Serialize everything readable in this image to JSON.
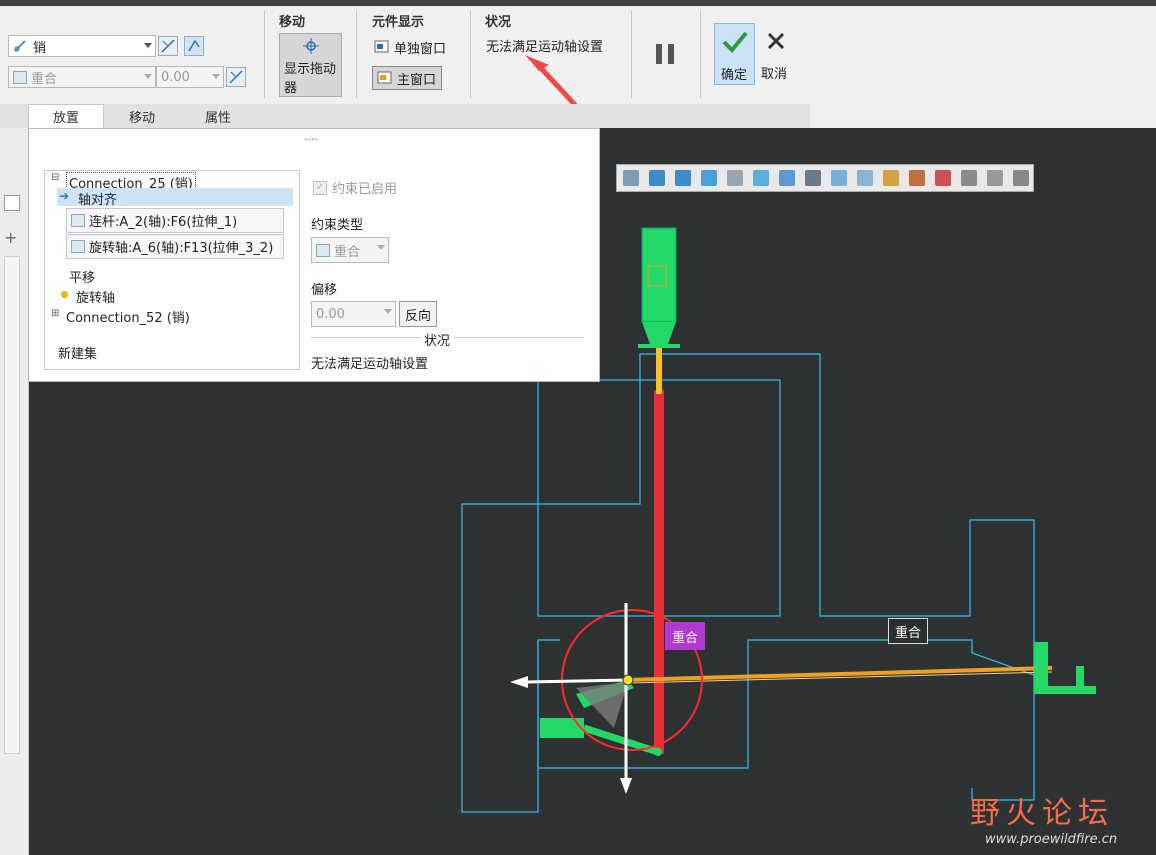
{
  "ribbon": {
    "connection_type": "销",
    "constraint_combo": "重合",
    "offset_value": "0.00",
    "groups": {
      "move": {
        "title": "移动",
        "drag_label_line1": "显示拖动",
        "drag_label_line2": "器"
      },
      "display": {
        "title": "元件显示",
        "separate_window": "单独窗口",
        "main_window": "主窗口"
      },
      "status": {
        "title": "状况",
        "message": "无法满足运动轴设置"
      },
      "confirm": {
        "ok": "确定",
        "cancel": "取消"
      }
    },
    "tabs": [
      "放置",
      "移动",
      "属性"
    ]
  },
  "panel": {
    "grip": "....",
    "tree": {
      "connection1": "Connection_25 (销)",
      "axis_align": "轴对齐",
      "ref1": "连杆:A_2(轴):F6(拉伸_1)",
      "ref2": "旋转轴:A_6(轴):F13(拉伸_3_2)",
      "translation": "平移",
      "rotation_axis": "旋转轴",
      "connection2": "Connection_52 (销)",
      "new_set": "新建集"
    },
    "enabled_label": "约束已启用",
    "constraint_type_label": "约束类型",
    "constraint_type_value": "重合",
    "offset_label": "偏移",
    "offset_value": "0.00",
    "flip_button": "反向",
    "status_label": "状况",
    "status_message": "无法满足运动轴设置"
  },
  "viewport": {
    "tag1": "重合",
    "tag2": "重合"
  },
  "watermark": {
    "text": "野火论坛",
    "url": "www.proewildfire.cn"
  }
}
